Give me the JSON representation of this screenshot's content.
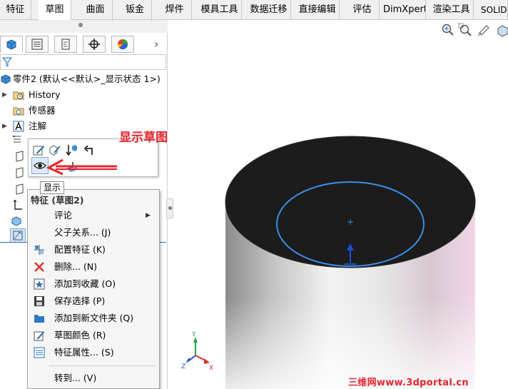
{
  "tabs": [
    {
      "label": "特征",
      "active": false
    },
    {
      "label": "草图",
      "active": true
    },
    {
      "label": "曲面",
      "active": false
    },
    {
      "label": "钣金",
      "active": false
    },
    {
      "label": "焊件",
      "active": false
    },
    {
      "label": "模具工具",
      "active": false
    },
    {
      "label": "数据迁移",
      "active": false
    },
    {
      "label": "直接编辑",
      "active": false
    },
    {
      "label": "评估",
      "active": false
    },
    {
      "label": "DimXpert",
      "active": false
    },
    {
      "label": "渲染工具",
      "active": false
    },
    {
      "label": "SOLIDW",
      "active": false
    }
  ],
  "tree": {
    "root": "零件2 (默认<<默认>_显示状态 1>)",
    "items": [
      {
        "label": "History",
        "icon": "history-folder-icon"
      },
      {
        "label": "传感器",
        "icon": "sensor-folder-icon"
      },
      {
        "label": "注解",
        "icon": "annotation-icon"
      }
    ]
  },
  "context_toolbar": {
    "tooltip": "显示"
  },
  "menu": {
    "header": "特征 (草图2)",
    "items": [
      {
        "label": "评论",
        "icon": "none",
        "submenu": true
      },
      {
        "label": "父子关系... (J)",
        "icon": "none",
        "submenu": false
      },
      {
        "label": "配置特征 (K)",
        "icon": "configure-icon",
        "submenu": false
      },
      {
        "label": "删除... (N)",
        "icon": "delete-icon",
        "submenu": false
      },
      {
        "label": "添加到收藏 (O)",
        "icon": "favorite-icon",
        "submenu": false
      },
      {
        "label": "保存选择 (P)",
        "icon": "save-selection-icon",
        "submenu": false
      },
      {
        "label": "添加到新文件夹 (Q)",
        "icon": "folder-icon",
        "submenu": false
      },
      {
        "label": "草图颜色 (R)",
        "icon": "sketch-color-icon",
        "submenu": false
      },
      {
        "label": "特征属性... (S)",
        "icon": "feature-properties-icon",
        "submenu": false
      },
      {
        "label": "转到... (V)",
        "icon": "none",
        "submenu": false
      }
    ]
  },
  "annotation": "显示草图",
  "watermark": "三维网www.3dportal.cn",
  "colors": {
    "accent_red": "#e8242c",
    "sketch_blue": "#3a8ee6",
    "top_face": "#1c1c1c"
  }
}
